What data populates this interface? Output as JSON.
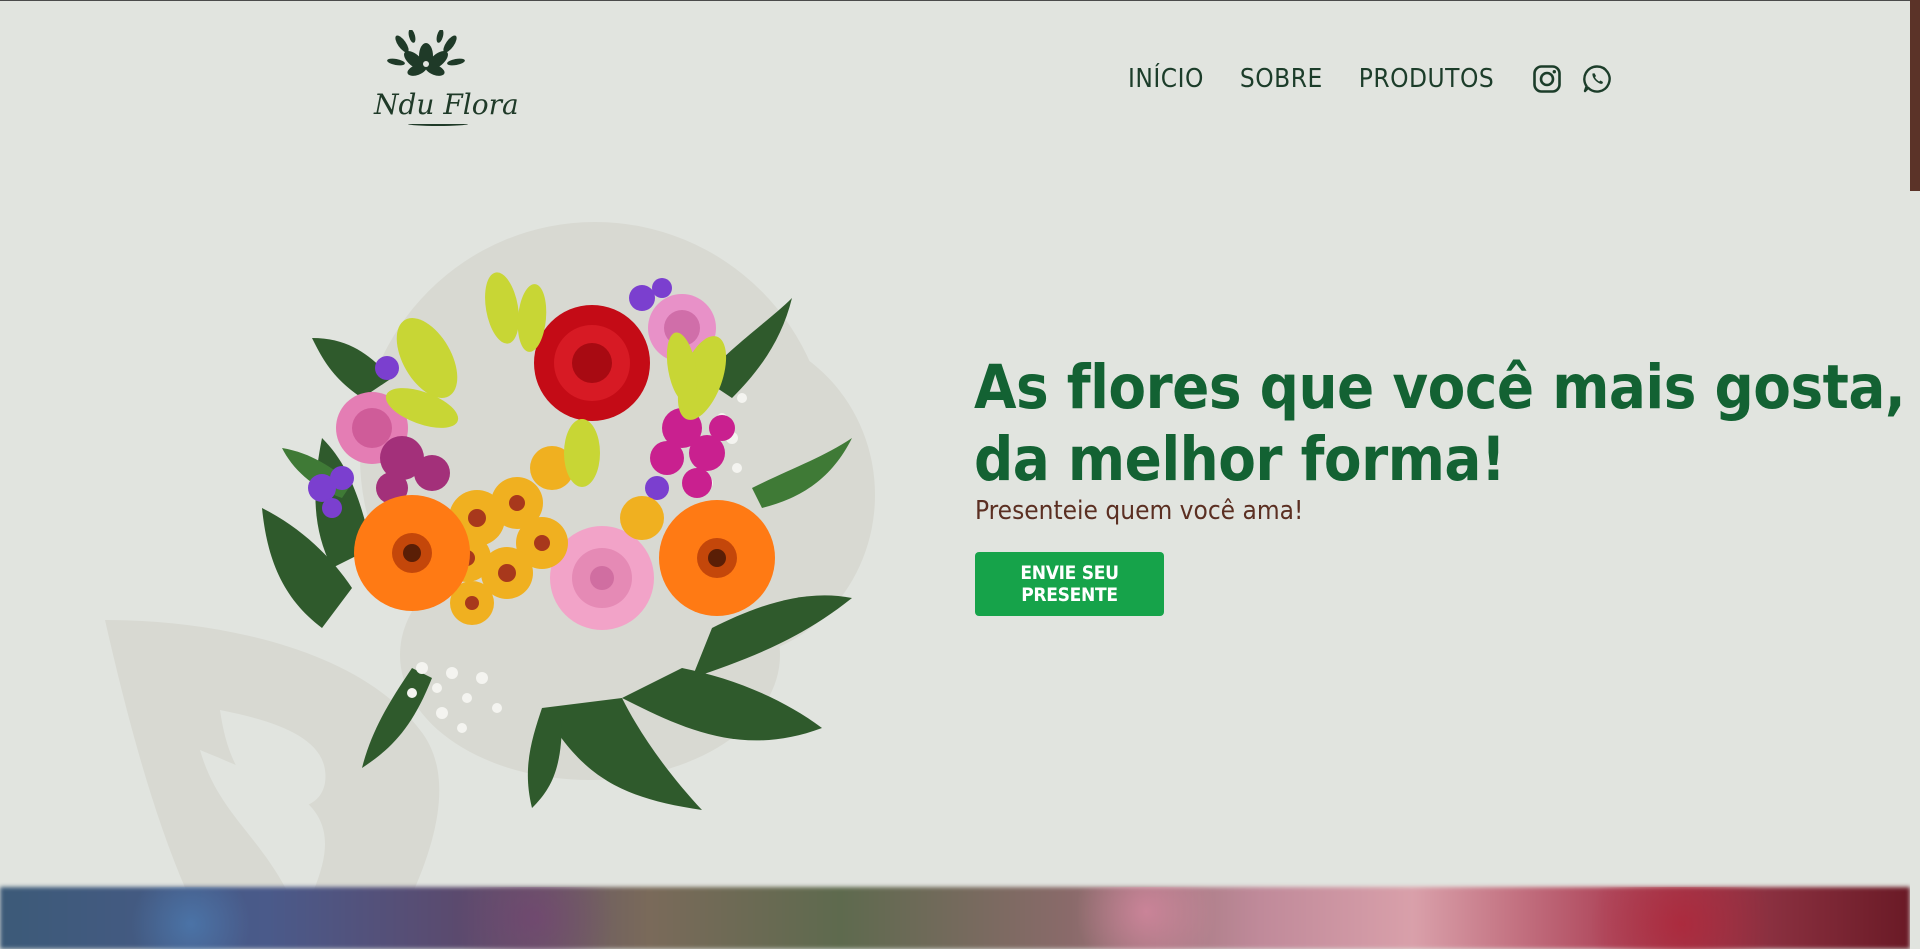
{
  "brand": {
    "name": "Ndu Flora"
  },
  "nav": {
    "items": [
      "INÍCIO",
      "SOBRE",
      "PRODUTOS"
    ]
  },
  "social": {
    "icons": [
      "instagram-icon",
      "whatsapp-icon"
    ]
  },
  "hero": {
    "title_line1": "As flores que você mais gosta,",
    "title_line2": "da melhor forma!",
    "subtitle": "Presenteie quem você ama!",
    "cta_label": "ENVIE SEU PRESENTE"
  },
  "colors": {
    "background": "#e1e4df",
    "primary_green": "#136233",
    "button_green": "#16a34a",
    "subtitle_brown": "#5b2f22",
    "nav_text": "#1c3d2a",
    "scrollbar": "#5b3328"
  }
}
